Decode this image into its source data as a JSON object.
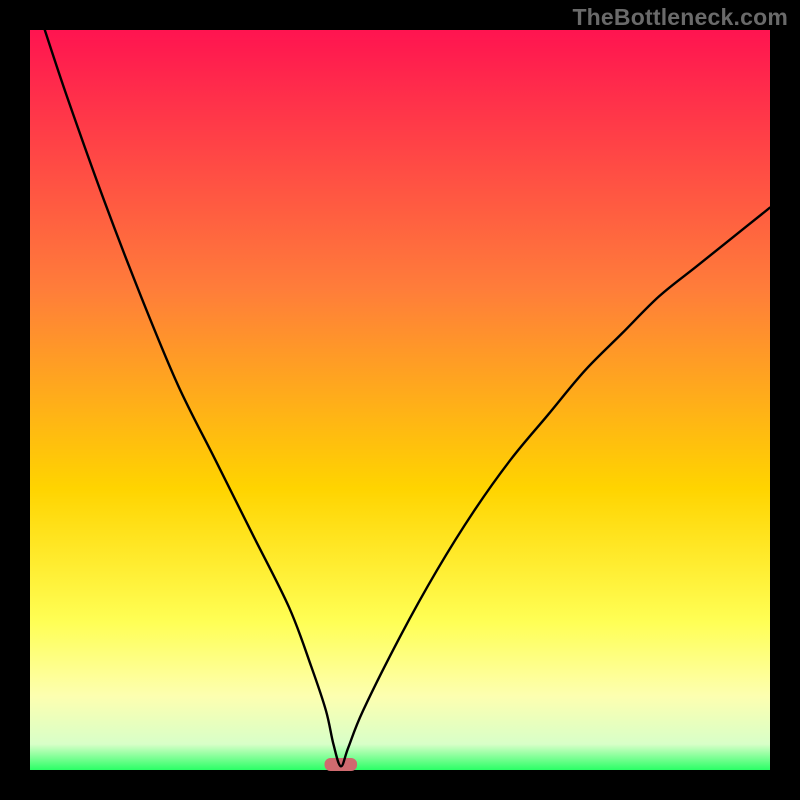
{
  "watermark": {
    "text": "TheBottleneck.com"
  },
  "chart_data": {
    "type": "line",
    "title": "",
    "xlabel": "",
    "ylabel": "",
    "xlim": [
      0,
      100
    ],
    "ylim": [
      0,
      100
    ],
    "grid": false,
    "legend": false,
    "series": [
      {
        "name": "curve",
        "x": [
          2,
          5,
          10,
          15,
          20,
          25,
          30,
          35,
          38,
          40,
          41,
          42,
          43,
          45,
          50,
          55,
          60,
          65,
          70,
          75,
          80,
          85,
          90,
          95,
          100
        ],
        "y": [
          100,
          91,
          77,
          64,
          52,
          42,
          32,
          22,
          14,
          8,
          3.5,
          0.5,
          3,
          8,
          18,
          27,
          35,
          42,
          48,
          54,
          59,
          64,
          68,
          72,
          76
        ]
      }
    ],
    "marker": {
      "x_center": 42,
      "half_width": 2.2,
      "y": 0.5,
      "color": "#cf6a6f"
    },
    "background": {
      "type": "vertical-gradient",
      "stops": [
        {
          "pos": 0.0,
          "color": "#ff1450"
        },
        {
          "pos": 0.35,
          "color": "#ff7d3a"
        },
        {
          "pos": 0.62,
          "color": "#ffd400"
        },
        {
          "pos": 0.8,
          "color": "#ffff55"
        },
        {
          "pos": 0.9,
          "color": "#fdffb0"
        },
        {
          "pos": 0.965,
          "color": "#d8ffc8"
        },
        {
          "pos": 1.0,
          "color": "#2bff66"
        }
      ]
    },
    "frame": {
      "border_px": 30,
      "border_color": "#000000"
    }
  }
}
